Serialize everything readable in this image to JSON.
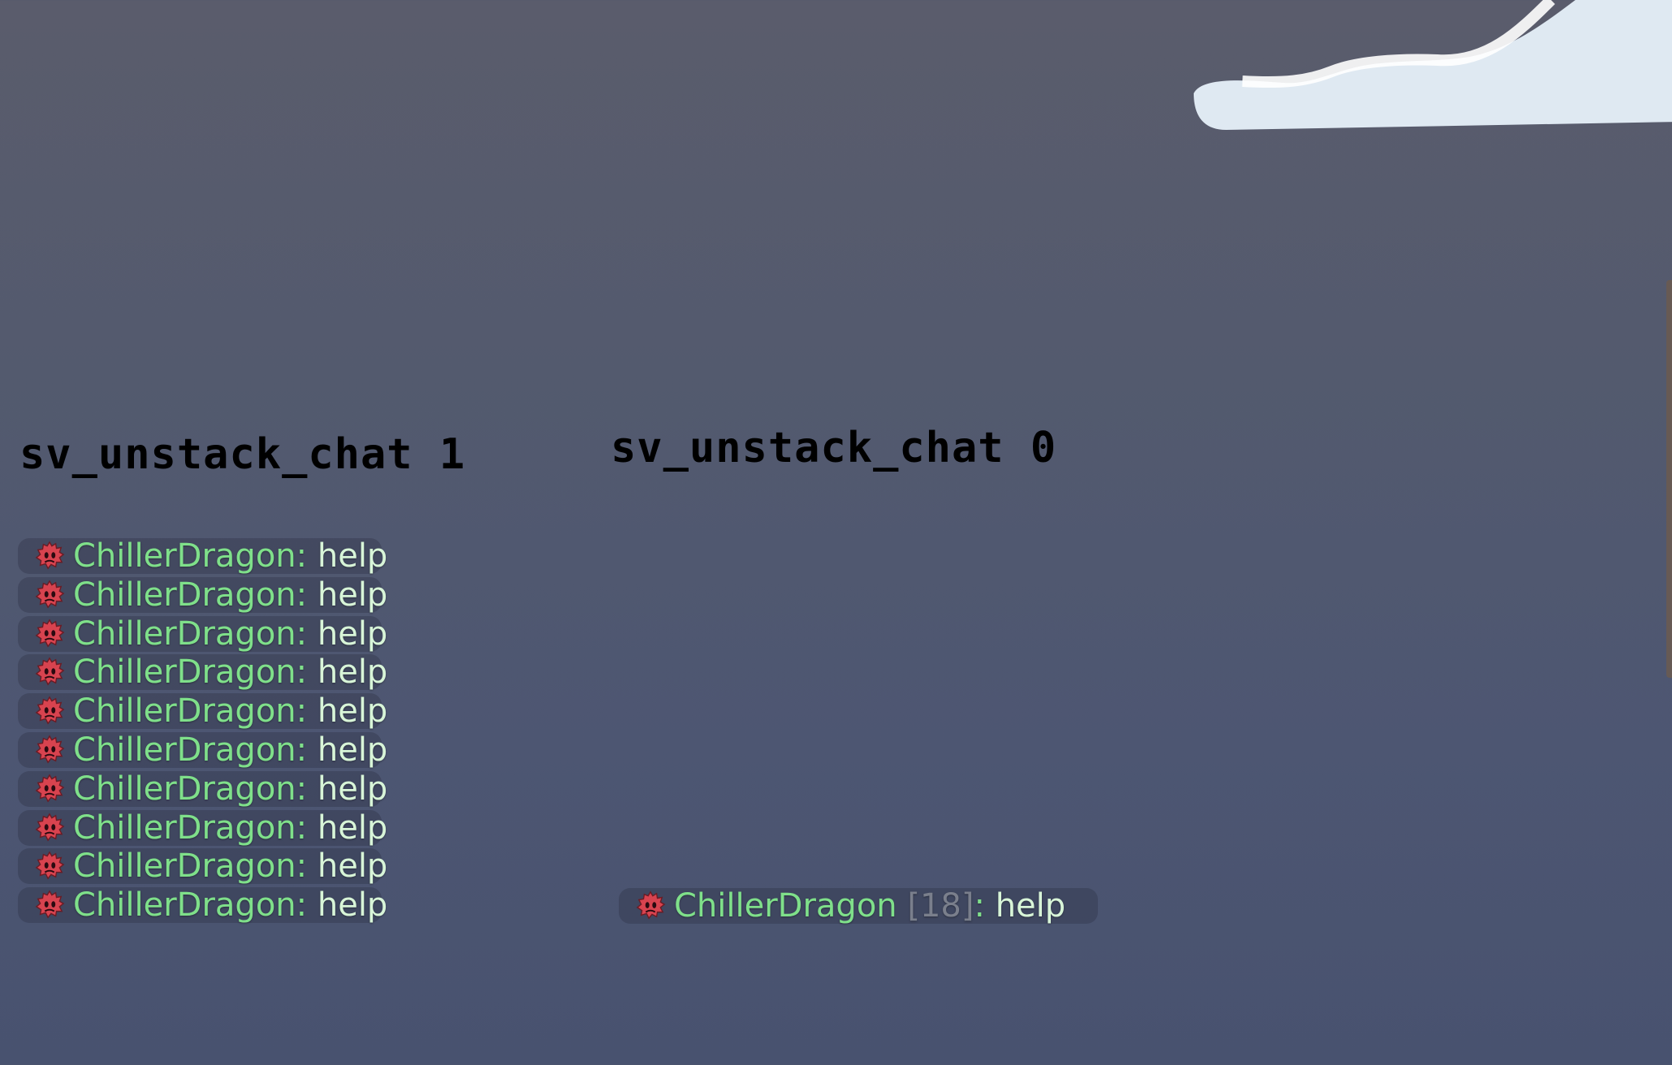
{
  "captions": {
    "left": "sv_unstack_chat 1",
    "right": "sv_unstack_chat 0"
  },
  "chat_left": [
    {
      "name": "ChillerDragon",
      "separator": ": ",
      "message": "help"
    },
    {
      "name": "ChillerDragon",
      "separator": ": ",
      "message": "help"
    },
    {
      "name": "ChillerDragon",
      "separator": ": ",
      "message": "help"
    },
    {
      "name": "ChillerDragon",
      "separator": ": ",
      "message": "help"
    },
    {
      "name": "ChillerDragon",
      "separator": ": ",
      "message": "help"
    },
    {
      "name": "ChillerDragon",
      "separator": ": ",
      "message": "help"
    },
    {
      "name": "ChillerDragon",
      "separator": ": ",
      "message": "help"
    },
    {
      "name": "ChillerDragon",
      "separator": ": ",
      "message": "help"
    },
    {
      "name": "ChillerDragon",
      "separator": ": ",
      "message": "help"
    },
    {
      "name": "ChillerDragon",
      "separator": ": ",
      "message": "help"
    }
  ],
  "chat_right": {
    "name": "ChillerDragon",
    "count": " [18]",
    "separator": ": ",
    "message": "help"
  },
  "colors": {
    "name": "#7fe08a",
    "message": "#d8f5d8",
    "count": "#7a7f8c",
    "tee": "#d8434f"
  },
  "icons": {
    "player": "tee-avatar-icon"
  }
}
